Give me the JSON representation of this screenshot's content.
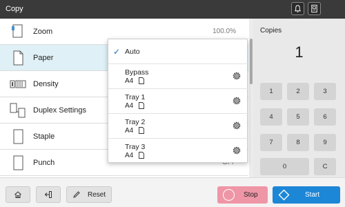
{
  "titlebar": {
    "title": "Copy"
  },
  "settings": {
    "zoom_label": "Zoom",
    "zoom_value": "100.0%",
    "paper_label": "Paper",
    "density_label": "Density",
    "duplex_label": "Duplex Settings",
    "staple_label": "Staple",
    "punch_label": "Punch",
    "punch_value": "OFF"
  },
  "paper_dropdown": {
    "auto_label": "Auto",
    "options": [
      {
        "name": "Bypass",
        "size": "A4"
      },
      {
        "name": "Tray 1",
        "size": "A4"
      },
      {
        "name": "Tray 2",
        "size": "A4"
      },
      {
        "name": "Tray 3",
        "size": "A4"
      }
    ]
  },
  "copies": {
    "label": "Copies",
    "value": "1",
    "keys": [
      "1",
      "2",
      "3",
      "4",
      "5",
      "6",
      "7",
      "8",
      "9",
      "0",
      "C"
    ]
  },
  "bottom": {
    "reset_label": "Reset",
    "stop_label": "Stop",
    "start_label": "Start"
  },
  "colors": {
    "titlebar": "#3a3a3a",
    "active_row": "#dff0f6",
    "stop": "#ef96a6",
    "start": "#1c86d7",
    "check": "#1f6ab0"
  }
}
